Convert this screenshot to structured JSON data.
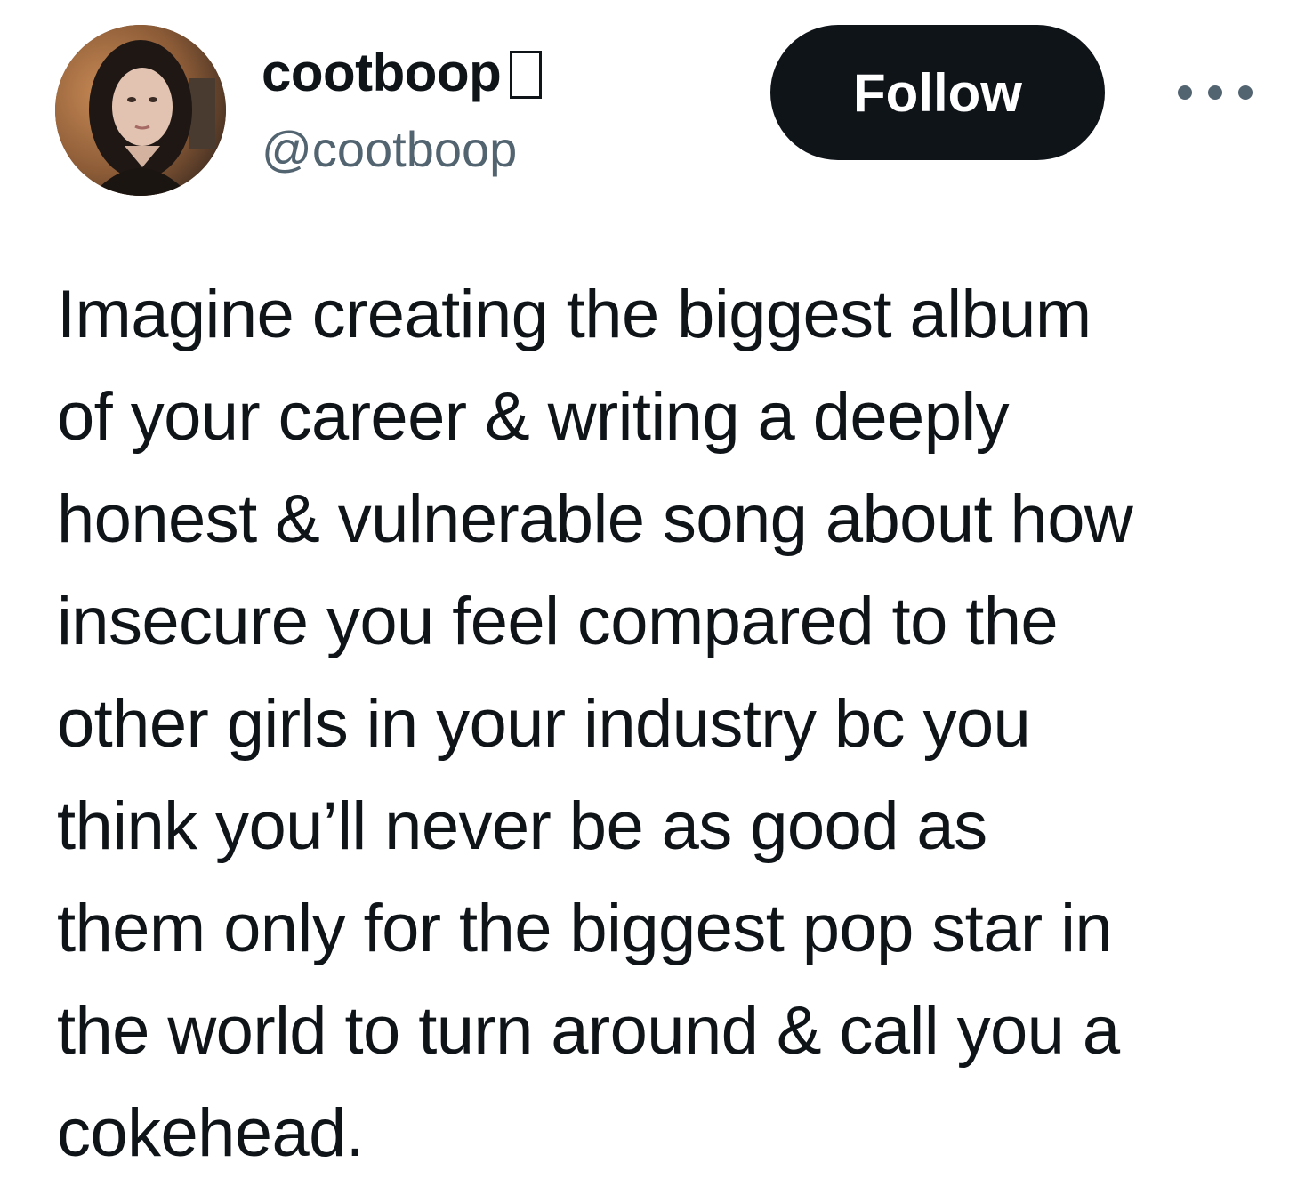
{
  "author": {
    "display_name": "cootboop",
    "handle": "@cootboop",
    "badge_glyph": "",
    "avatar_icon": "user-photo"
  },
  "actions": {
    "follow_label": "Follow",
    "more_icon": "more-horizontal-icon"
  },
  "tweet": {
    "lines": [
      "Imagine creating the biggest album",
      "of your career & writing a deeply",
      "honest & vulnerable song about how",
      "insecure you feel compared to the",
      "other girls in your industry bc you",
      "think you’ll never be as good as",
      "them only for the biggest pop star in",
      "the world to turn around & call you a",
      "cokehead."
    ]
  },
  "colors": {
    "text_primary": "#0f1419",
    "text_secondary": "#536471",
    "button_bg": "#0f1419",
    "button_text": "#ffffff",
    "background": "#ffffff"
  }
}
